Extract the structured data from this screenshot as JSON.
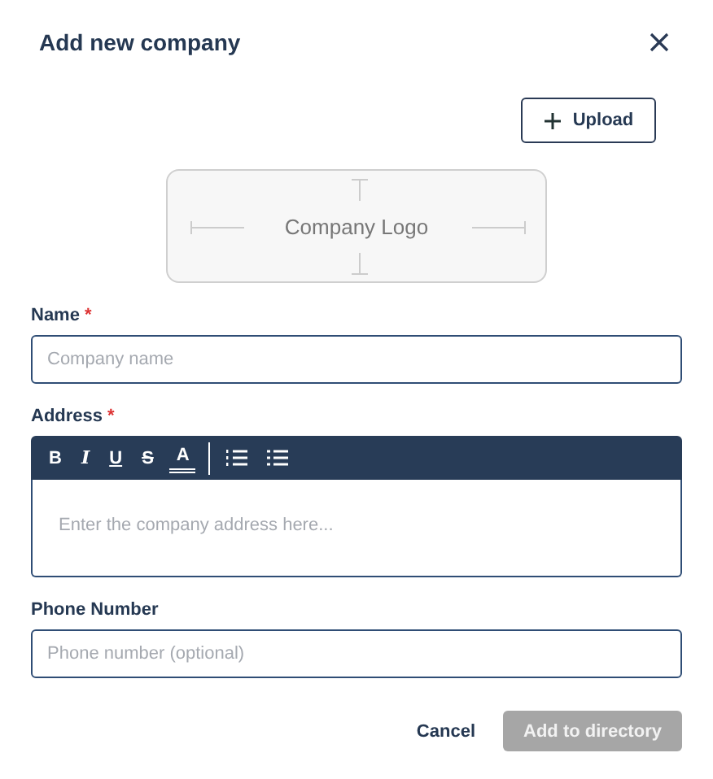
{
  "dialog": {
    "title": "Add new company"
  },
  "upload_button": {
    "label": "Upload"
  },
  "logo_placeholder": {
    "text": "Company Logo"
  },
  "fields": [
    {
      "kind": "input",
      "label": "Name",
      "required_mark": "*",
      "placeholder": "Company name"
    },
    {
      "kind": "rich",
      "label": "Address",
      "required_mark": "*",
      "placeholder": "Enter the company address here...",
      "toolbar": [
        {
          "kind": "bold",
          "text": "B"
        },
        {
          "kind": "italic",
          "text": "I"
        },
        {
          "kind": "underline",
          "text": "U"
        },
        {
          "kind": "strike",
          "text": "S"
        },
        {
          "kind": "color",
          "text": "A"
        },
        {
          "kind": "divider"
        },
        {
          "kind": "ordered-list"
        },
        {
          "kind": "bullet-list"
        }
      ]
    },
    {
      "kind": "input",
      "label": "Phone Number",
      "placeholder": "Phone number (optional)"
    }
  ],
  "actions": [
    {
      "kind": "text",
      "label": "Cancel",
      "disabled": false
    },
    {
      "kind": "primary",
      "label": "Add to directory",
      "disabled": true
    }
  ]
}
